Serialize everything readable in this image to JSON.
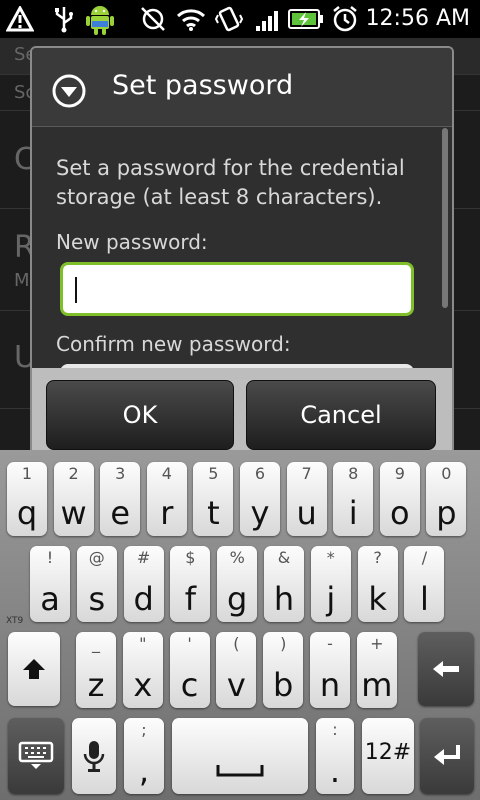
{
  "status_bar": {
    "time": "12:56 AM",
    "icons": [
      "warning-icon",
      "usb-icon",
      "android-debug-icon",
      "sync-off-icon",
      "wifi-icon",
      "vibrate-icon",
      "signal-icon",
      "battery-charging-icon",
      "alarm-icon"
    ]
  },
  "background": {
    "rows": [
      "Se",
      "Sc",
      "C",
      "R",
      "M",
      "U"
    ]
  },
  "dialog": {
    "title": "Set password",
    "message": "Set a password for the credential storage (at least 8 characters).",
    "new_password_label": "New password:",
    "new_password_value": "",
    "confirm_password_label": "Confirm new password:",
    "ok_label": "OK",
    "cancel_label": "Cancel"
  },
  "keyboard": {
    "row1": [
      {
        "main": "q",
        "sub": "1"
      },
      {
        "main": "w",
        "sub": "2"
      },
      {
        "main": "e",
        "sub": "3"
      },
      {
        "main": "r",
        "sub": "4"
      },
      {
        "main": "t",
        "sub": "5"
      },
      {
        "main": "y",
        "sub": "6"
      },
      {
        "main": "u",
        "sub": "7"
      },
      {
        "main": "i",
        "sub": "8"
      },
      {
        "main": "o",
        "sub": "9"
      },
      {
        "main": "p",
        "sub": "0"
      }
    ],
    "row2": [
      {
        "main": "a",
        "sub": "!"
      },
      {
        "main": "s",
        "sub": "@"
      },
      {
        "main": "d",
        "sub": "#"
      },
      {
        "main": "f",
        "sub": "$"
      },
      {
        "main": "g",
        "sub": "%"
      },
      {
        "main": "h",
        "sub": "&"
      },
      {
        "main": "j",
        "sub": "*"
      },
      {
        "main": "k",
        "sub": "?"
      },
      {
        "main": "l",
        "sub": "/"
      }
    ],
    "row3": [
      {
        "main": "z",
        "sub": "_"
      },
      {
        "main": "x",
        "sub": "\""
      },
      {
        "main": "c",
        "sub": "'"
      },
      {
        "main": "v",
        "sub": "("
      },
      {
        "main": "b",
        "sub": ")"
      },
      {
        "main": "n",
        "sub": "-"
      },
      {
        "main": "m",
        "sub": "+"
      }
    ],
    "xt9_label": "XT9",
    "comma_key": {
      "main": ",",
      "sub": ";"
    },
    "period_key": {
      "main": ".",
      "sub": ":"
    },
    "numbers_label": "12#"
  },
  "colors": {
    "focus_border": "#7fbf2a",
    "dialog_bg": "#2f2f2f"
  }
}
